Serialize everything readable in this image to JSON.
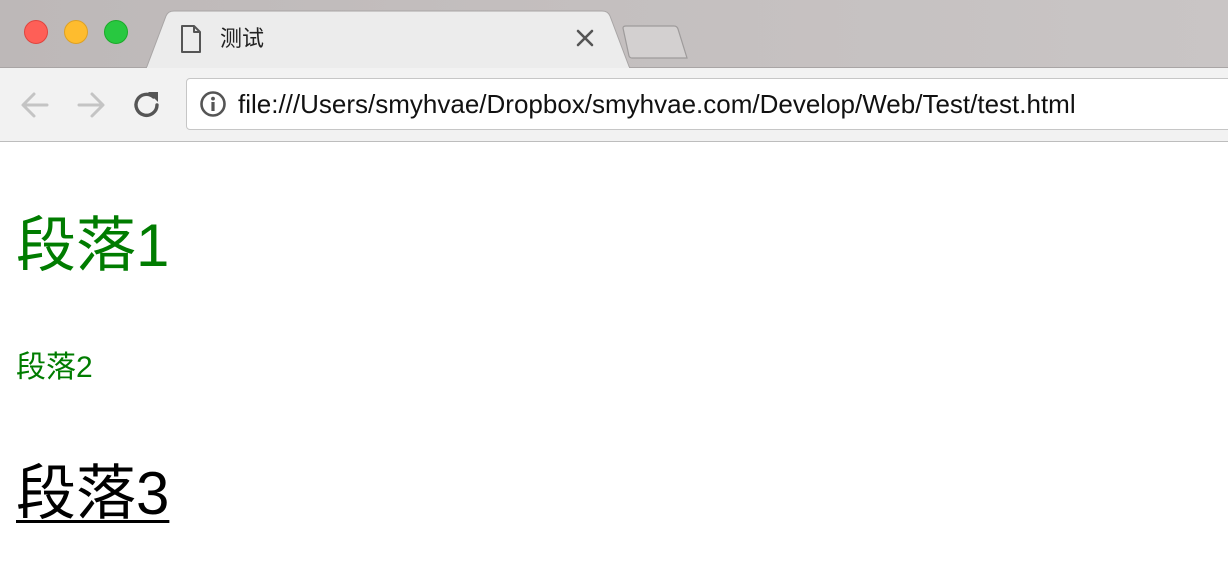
{
  "browser": {
    "window_controls": {
      "close_icon": "close-dot",
      "minimize_icon": "minimize-dot",
      "zoom_icon": "zoom-dot",
      "colors": {
        "close": "#fe5f57",
        "minimize": "#febc2e",
        "zoom": "#28c840"
      }
    },
    "tab": {
      "title": "测试",
      "icon": "document-icon",
      "close_icon": "close-icon"
    },
    "new_tab_icon": "new-tab-icon",
    "toolbar": {
      "back_icon": "arrow-left-icon",
      "forward_icon": "arrow-right-icon",
      "reload_icon": "reload-icon",
      "info_icon": "info-icon",
      "url": "file:///Users/smyhvae/Dropbox/smyhvae.com/Develop/Web/Test/test.html"
    }
  },
  "page": {
    "paragraphs": [
      {
        "text": "段落1",
        "color": "#007c00"
      },
      {
        "text": "段落2",
        "color": "#007c00"
      },
      {
        "text": "段落3",
        "color": "#000000",
        "underline": true
      }
    ]
  }
}
